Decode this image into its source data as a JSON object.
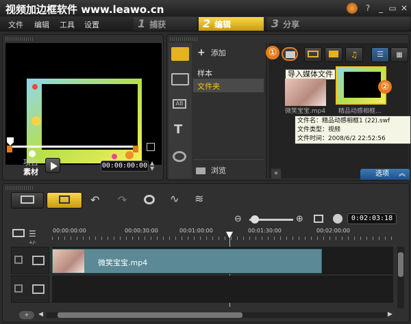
{
  "app": {
    "title": "视频加边框软件 www.leawo.cn"
  },
  "menu": [
    "文件",
    "编辑",
    "工具",
    "设置"
  ],
  "steps": [
    {
      "num": "1",
      "label": "捕获"
    },
    {
      "num": "2",
      "label": "编辑"
    },
    {
      "num": "3",
      "label": "分享"
    }
  ],
  "preview": {
    "project_label": "项目",
    "clip_label": "素材",
    "timecode": "00:00:00:00"
  },
  "library": {
    "add_label": "添加",
    "folders": [
      "样本",
      "文件夹"
    ],
    "browse_label": "浏览",
    "options_label": "选项",
    "tooltip": "导入媒体文件",
    "thumbs": [
      {
        "caption": "微笑宝宝.mp4"
      },
      {
        "caption": "精品动感相框..."
      }
    ],
    "info": {
      "line1": "文件名：精品动感相框1 (22).swf",
      "line2": "文件类型：视频",
      "line3": "文件时间：2008/6/2 22:52:56"
    },
    "markers": [
      "①",
      "②"
    ]
  },
  "timeline": {
    "timecode": "0:02:03:18",
    "ruler": [
      "00:00:00:00",
      "00:00:30:00",
      "00:01:00:00",
      "00:01:30:00",
      "00:02:00:00"
    ],
    "clip_name": "微笑宝宝.mp4"
  },
  "colors": {
    "accent": "#f5c518",
    "orange": "#e87b1e",
    "clip": "#5b8a96",
    "selected": "#4a4a4a"
  }
}
